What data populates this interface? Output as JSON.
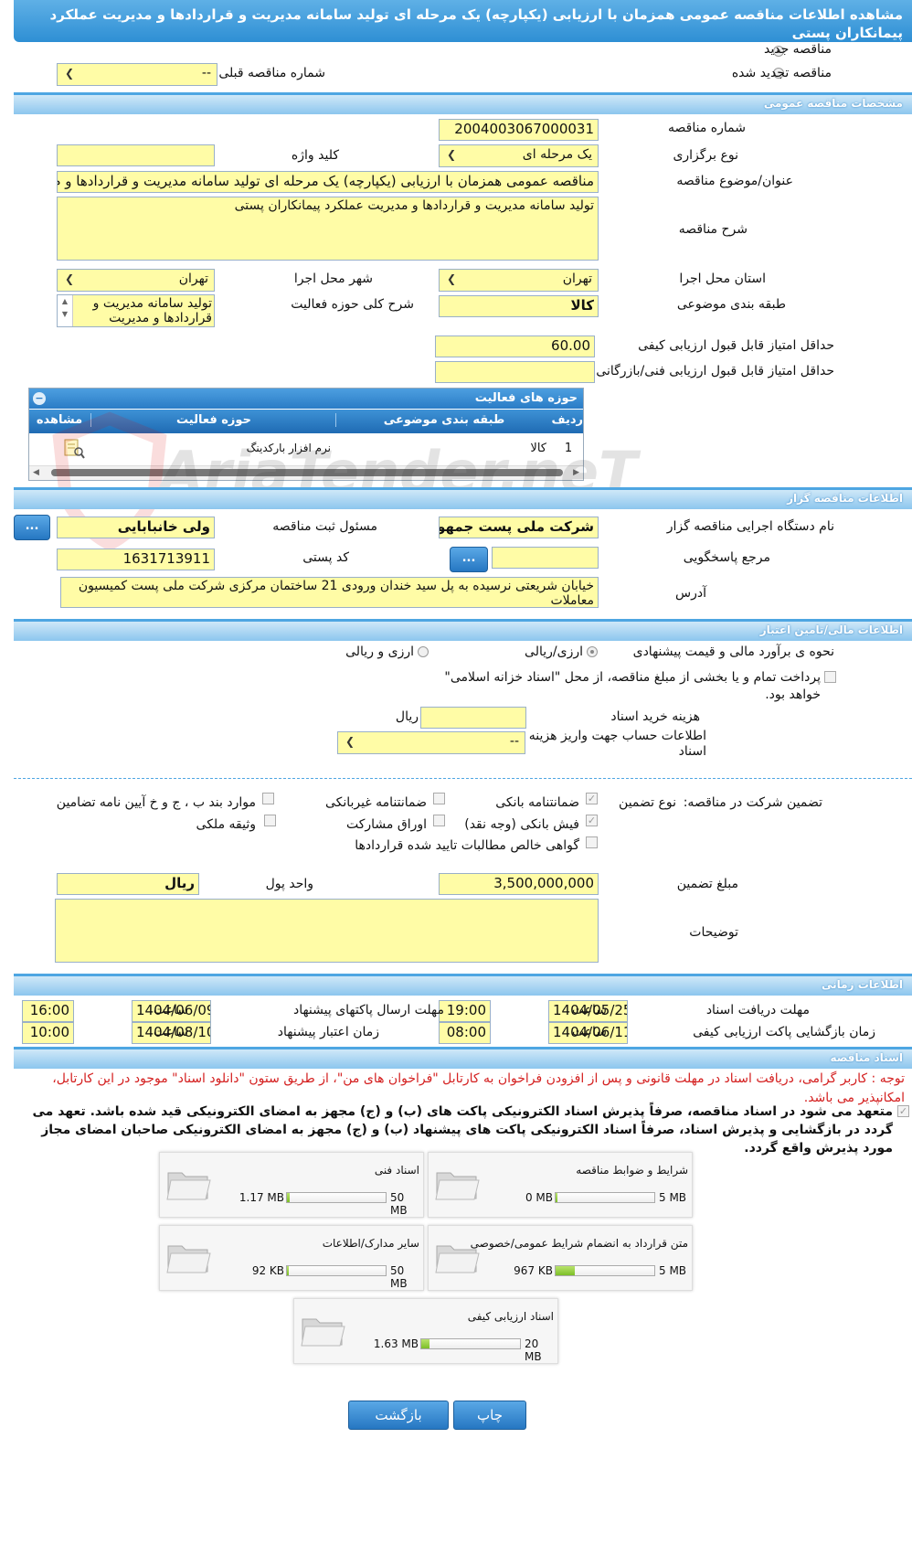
{
  "title": "مشاهده اطلاعات مناقصه عمومی همزمان با ارزیابی (یکپارچه) یک مرحله ای تولید سامانه مدیریت و قراردادها و مدیریت عملکرد پیمانکاران پستی",
  "top": {
    "new_tender": "مناقصه جدید",
    "renewed_tender": "مناقصه تجدید شده",
    "prev_number_label": "شماره مناقصه قبلی",
    "prev_number_value": "--"
  },
  "general": {
    "section": "مشخصات مناقصه عمومی",
    "number_label": "شماره مناقصه",
    "number_value": "2004003067000031",
    "type_label": "نوع برگزاری",
    "type_value": "یک مرحله ای",
    "keyword_label": "کلید واژه",
    "keyword_value": "",
    "subject_label": "عنوان/موضوع مناقصه",
    "subject_value": "مناقصه عمومی همزمان با ارزیابی (یکپارچه) یک مرحله ای تولید سامانه مدیریت و قراردادها و م",
    "desc_label": "شرح مناقصه",
    "desc_value": "تولید سامانه مدیریت و قراردادها و مدیریت عملکرد پیمانکاران پستی",
    "province_label": "استان محل اجرا",
    "province_value": "تهران",
    "city_label": "شهر محل اجرا",
    "city_value": "تهران",
    "category_label": "طبقه بندی موضوعی",
    "category_value": "کالا",
    "activity_desc_label": "شرح کلی حوزه فعالیت",
    "activity_desc_value": "تولید سامانه مدیریت و قراردادها و مدیریت عملکرد",
    "min_quality_label": "حداقل امتیاز قابل قبول ارزیابی کیفی",
    "min_quality_value": "60.00",
    "min_tech_label": "حداقل امتیاز قابل قبول ارزیابی فنی/بازرگانی",
    "min_tech_value": ""
  },
  "activity_grid": {
    "title": "حوزه های فعالیت",
    "col_row": "ردیف",
    "col_category": "طبقه بندی موضوعی",
    "col_activity": "حوزه فعالیت",
    "col_view": "مشاهده",
    "rows": [
      {
        "row": "1",
        "category": "کالا",
        "activity": "نرم افزار بارکدینگ"
      }
    ]
  },
  "watermark": "AriaTender.neT",
  "organizer": {
    "section": "اطلاعات مناقصه گزار",
    "org_label": "نام دستگاه اجرایی مناقصه گزار",
    "org_value": "شرکت ملی پست جمهوری",
    "officer_label": "مسئول ثبت مناقصه",
    "officer_value": "ولی خانبابایی",
    "ref_label": "مرجع پاسخگویی",
    "ref_value": "",
    "postal_label": "کد پستی",
    "postal_value": "1631713911",
    "address_label": "آدرس",
    "address_value": "خیابان شریعتی نرسیده به پل سید خندان ورودی 21 ساختمان مرکزی شرکت ملی پست کمیسیون معاملات",
    "dots": "..."
  },
  "finance": {
    "section": "اطلاعات مالی/تامین اعتبار",
    "estimate_label": "نحوه ی برآورد مالی و قیمت پیشنهادی",
    "opt1": "ارزی/ریالی",
    "opt2": "ارزی و ریالی",
    "treasury_text": "پرداخت تمام و یا بخشی از مبلغ مناقصه، از محل \"اسناد خزانه اسلامی\" خواهد بود.",
    "doc_cost_label": "هزینه خرید اسناد",
    "doc_cost_unit": "ریال",
    "account_label": "اطلاعات حساب جهت واریز هزینه خرید اسناد",
    "account_value": "--"
  },
  "guarantee": {
    "label": "تضمین شرکت در مناقصه:",
    "type_label": "نوع تضمین",
    "bank_guarantee": "ضمانتنامه بانکی",
    "non_bank_guarantee": "ضمانتنامه غیربانکی",
    "items_bcd": "موارد بند ب ، ج و خ آیین نامه تضامین",
    "bank_receipt": "فیش بانکی (وجه نقد)",
    "bonds": "اوراق مشارکت",
    "property": "وثیقه ملکی",
    "receivables": "گواهی خالص مطالبات تایید شده قراردادها",
    "amount_label": "مبلغ تضمین",
    "amount_value": "3,500,000,000",
    "currency_label": "واحد پول",
    "currency_value": "ریال",
    "notes_label": "توضیحات",
    "notes_value": ""
  },
  "timing": {
    "section": "اطلاعات زمانی",
    "doc_deadline_label": "مهلت دریافت اسناد",
    "doc_deadline_date": "1404/05/25",
    "doc_deadline_time": "19:00",
    "send_deadline_label": "مهلت ارسال پاکتهای پیشنهاد",
    "send_deadline_date": "1404/06/09",
    "send_deadline_time": "16:00",
    "opening_label": "زمان بازگشایی پاکت ارزیابی کیفی",
    "opening_date": "1404/06/11",
    "opening_time": "08:00",
    "validity_label": "زمان اعتبار پیشنهاد",
    "validity_date": "1404/08/10",
    "validity_time": "10:00",
    "time_label": "ساعت"
  },
  "documents": {
    "section": "اسناد مناقصه",
    "note": "توجه : کاربر گرامی، دریافت اسناد در مهلت قانونی و پس از افزودن فراخوان به کارتابل \"فراخوان های من\"، از طریق ستون \"دانلود اسناد\" موجود در این کارتابل، امکانپذیر می باشد.",
    "commit": "متعهد می شود در اسناد مناقصه، صرفاً پذیرش اسناد الکترونیکی پاکت های (ب) و (ج) مجهز به امضای الکترونیکی قید شده باشد. تعهد می گردد در بازگشایی و پذیرش اسناد، صرفاً اسناد الکترونیکی پاکت های پیشنهاد (ب) و (ج) مجهز به امضای الکترونیکی صاحبان امضای مجاز مورد پذیرش واقع گردد.",
    "cards": [
      {
        "name": "شرایط و ضوابط مناقصه",
        "used": "0 MB",
        "max": "5 MB",
        "fill": 0
      },
      {
        "name": "اسناد فنی",
        "used": "1.17 MB",
        "max": "50 MB",
        "fill": 0.03
      },
      {
        "name": "متن قرارداد به انضمام شرایط عمومی/خصوصی",
        "used": "967 KB",
        "max": "5 MB",
        "fill": 0.19
      },
      {
        "name": "سایر مدارک/اطلاعات",
        "used": "92 KB",
        "max": "50 MB",
        "fill": 0.005
      },
      {
        "name": "اسناد ارزیابی کیفی",
        "used": "1.63 MB",
        "max": "20 MB",
        "fill": 0.08
      }
    ]
  },
  "buttons": {
    "print": "چاپ",
    "back": "بازگشت"
  }
}
